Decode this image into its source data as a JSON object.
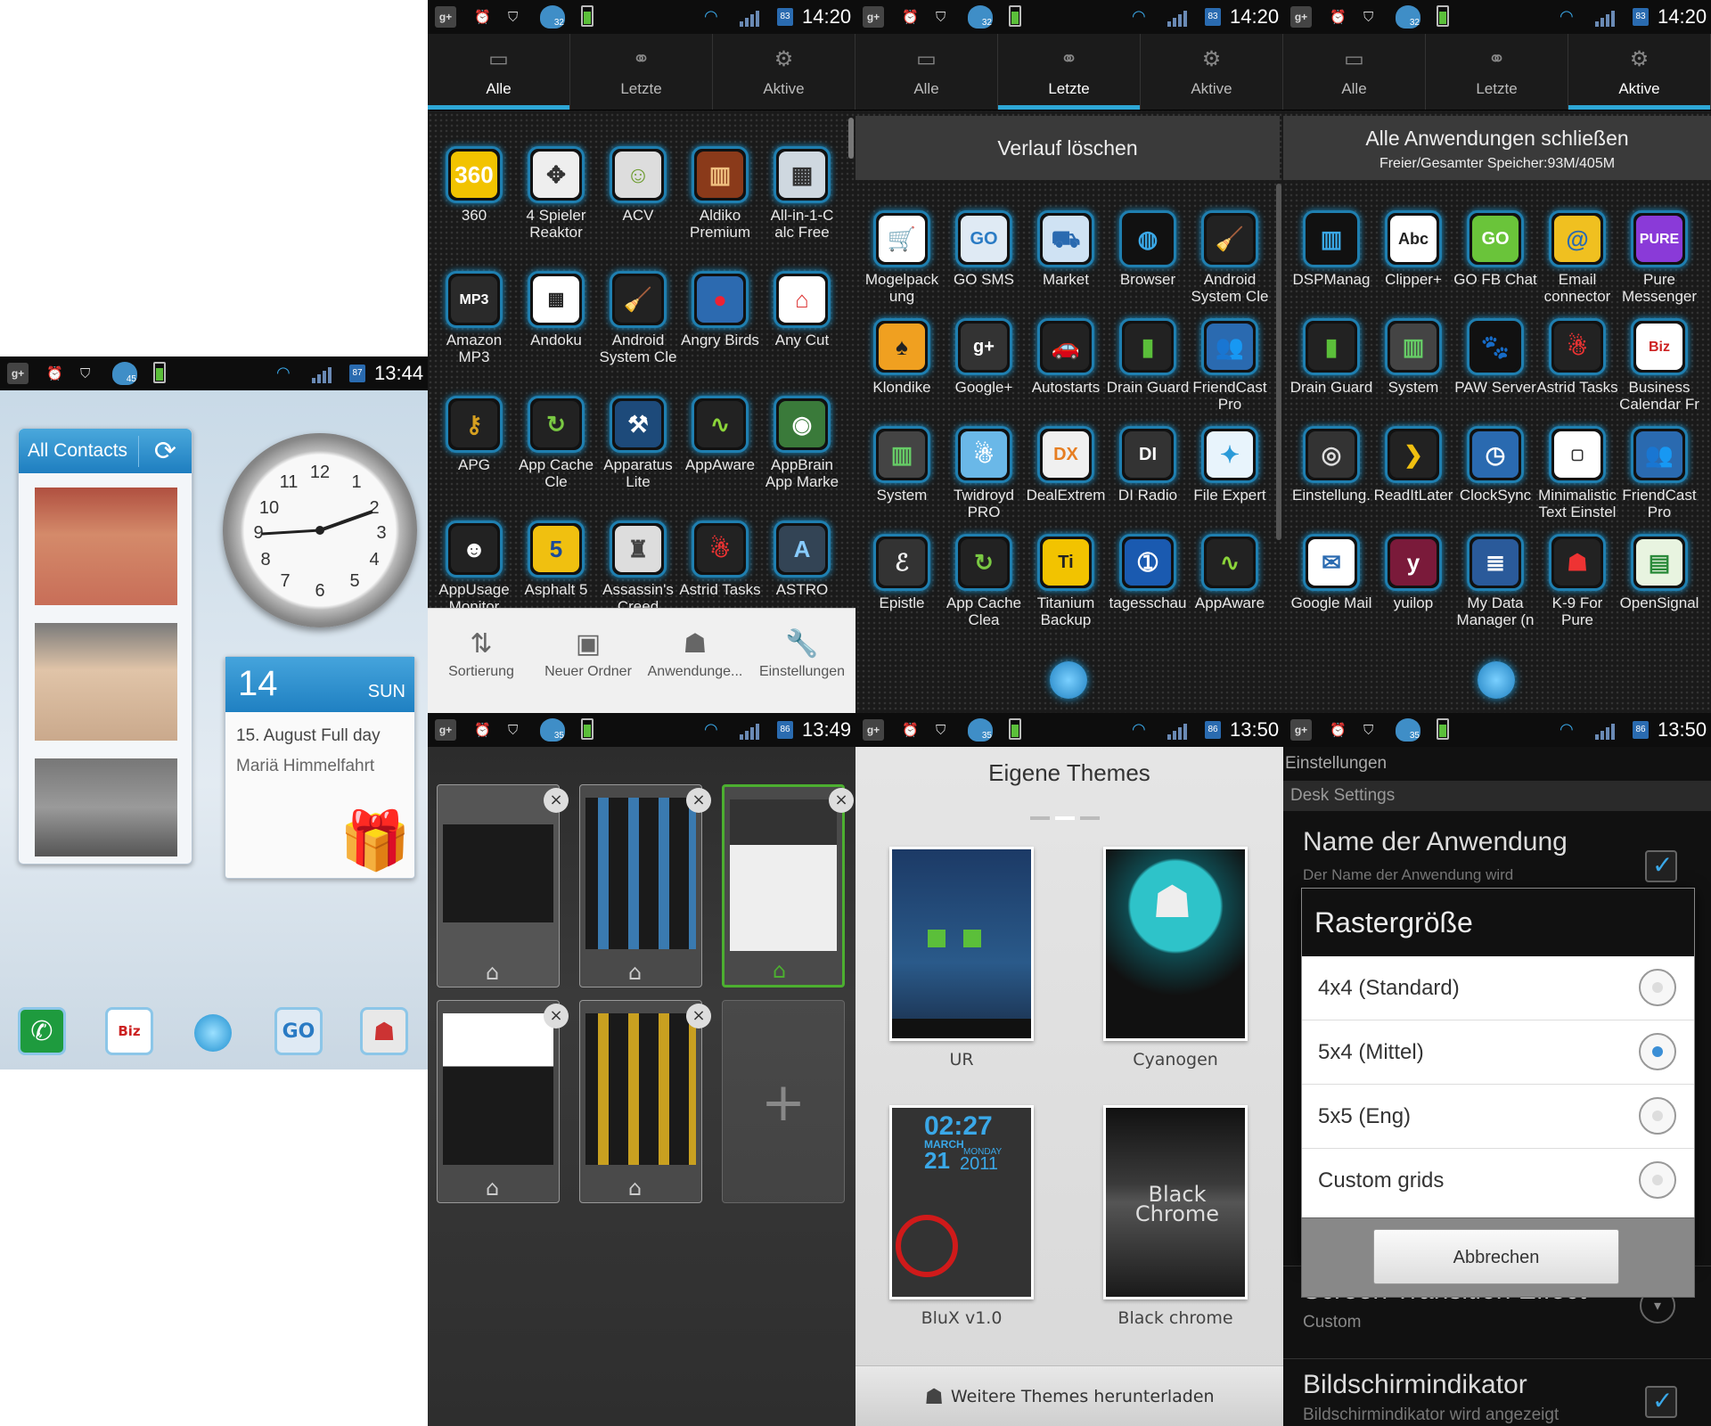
{
  "colors": {
    "accent": "#2ea7d6",
    "dark_bg": "#1a1a1a",
    "light_panel": "#e8e8e8"
  },
  "status_bars": [
    {
      "time": "13:44",
      "battery": "87",
      "badge": "45"
    },
    {
      "time": "14:20",
      "battery": "83",
      "badge": "32"
    },
    {
      "time": "14:20",
      "battery": "83",
      "badge": "32"
    },
    {
      "time": "14:20",
      "battery": "83",
      "badge": "32"
    },
    {
      "time": "13:49",
      "battery": "86",
      "badge": "35"
    },
    {
      "time": "13:50",
      "battery": "86",
      "badge": "35"
    },
    {
      "time": "13:50",
      "battery": "86",
      "badge": "35"
    }
  ],
  "home": {
    "contacts_title": "All Contacts",
    "calendar": {
      "day": "14",
      "weekday": "SUN",
      "event_line1": "15. August  Full day",
      "event_line2": "Mariä Himmelfahrt"
    },
    "dock_icons": [
      "phone-icon",
      "calendar-icon",
      "home-dot-icon",
      "chat-icon",
      "robot-icon"
    ]
  },
  "tabs": {
    "all": "Alle",
    "recent": "Letzte",
    "active": "Aktive"
  },
  "drawer": {
    "apps": [
      "360",
      "4 Spieler Reaktor",
      "ACV",
      "Aldiko Premium",
      "All-in-1-C alc Free",
      "Amazon MP3",
      "Andoku",
      "Android System Cle",
      "Angry Birds",
      "Any Cut",
      "APG",
      "App Cache Cle",
      "Apparatus Lite",
      "AppAware",
      "AppBrain App Marke",
      "AppUsage Monitor",
      "Asphalt 5",
      "Assassin's Creed",
      "Astrid Tasks",
      "ASTRO"
    ],
    "toolbar": [
      "Sortierung",
      "Neuer Ordner",
      "Anwendunge...",
      "Einstellungen"
    ]
  },
  "recent": {
    "clear": "Verlauf löschen",
    "apps": [
      "Mogelpack ung",
      "GO SMS",
      "Market",
      "Browser",
      "Android System Cle",
      "Klondike",
      "Google+",
      "Autostarts",
      "Drain Guard",
      "FriendCast Pro",
      "System",
      "Twidroyd PRO",
      "DealExtrem",
      "DI Radio",
      "File Expert",
      "Epistle",
      "App Cache Clea",
      "Titanium Backup",
      "tagesschau",
      "AppAware"
    ]
  },
  "active": {
    "close_all": "Alle Anwendungen schließen",
    "memory": "Freier/Gesamter Speicher:93M/405M",
    "apps": [
      "DSPManag",
      "Clipper+",
      "GO FB Chat",
      "Email connector",
      "Pure Messenger",
      "Drain Guard",
      "System",
      "PAW Server",
      "Astrid Tasks",
      "Business Calendar Fr",
      "Einstellung.",
      "ReadItLater",
      "ClockSync",
      "Minimalistic Text Einstel",
      "FriendCast Pro",
      "Google Mail",
      "yuilop",
      "My Data Manager (n",
      "K-9 For Pure",
      "OpenSignal"
    ]
  },
  "themes": {
    "title": "Eigene Themes",
    "items": [
      "UR",
      "Cyanogen",
      "BluX v1.0",
      "Black chrome"
    ],
    "thumb_texts": {
      "blux_time": "02:27",
      "blux_month": "MARCH",
      "blux_day": "21",
      "blux_weekday": "MONDAY",
      "blux_year": "2011",
      "black_chrome": "Black Chrome"
    },
    "download": "Weitere Themes herunterladen"
  },
  "settings": {
    "header": "Einstellungen",
    "section": "Desk Settings",
    "name_title": "Name der Anwendung",
    "name_sub": "Der Name der Anwendung wird",
    "transition_title": "Screen Transition Effect",
    "transition_sub": "Custom",
    "indicator_title": "Bildschirmindikator",
    "indicator_sub": "Bildschirmindikator wird angezeigt",
    "dialog": {
      "title": "Rastergröße",
      "options": [
        "4x4 (Standard)",
        "5x4 (Mittel)",
        "5x5 (Eng)",
        "Custom grids"
      ],
      "selected": 1,
      "cancel": "Abbrechen"
    }
  }
}
